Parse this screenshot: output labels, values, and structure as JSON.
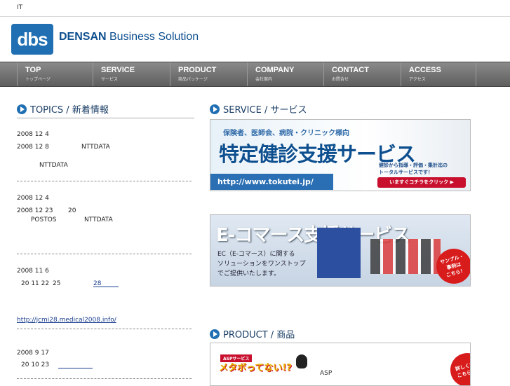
{
  "topbar": {
    "text": "IT"
  },
  "header": {
    "logo": "dbs",
    "brand_bold": "DENSAN",
    "brand_rest": " Business Solution"
  },
  "nav": [
    {
      "en": "TOP",
      "jp": "トップページ"
    },
    {
      "en": "SERVICE",
      "jp": "サービス"
    },
    {
      "en": "PRODUCT",
      "jp": "商品パッケージ"
    },
    {
      "en": "COMPANY",
      "jp": "会社案内"
    },
    {
      "en": "CONTACT",
      "jp": "お問合せ"
    },
    {
      "en": "ACCESS",
      "jp": "アクセス"
    }
  ],
  "topics": {
    "title": "TOPICS / 新着情報",
    "lines": [
      "2008 12 4",
      "2008 12 8",
      "NTTDATA",
      "NTTDATA",
      "2008 12 4",
      "2008 12 23",
      "20",
      "POSTOS",
      "NTTDATA",
      "2008 11 6",
      "20 11 22",
      "25",
      "28",
      "http://jcmi28.medical2008.info/",
      "2008 9 17",
      "20 10 23"
    ]
  },
  "service": {
    "title": "SERVICE / サービス",
    "banner1": {
      "tagline": "保険者、医師会、病院・クリニック様向",
      "headline": "特定健診支援サービス",
      "url": "http://www.tokutei.jp/",
      "desc1": "健診から指導・評価・集計迄の",
      "desc2": "トータルサービスです！",
      "cta": "いますぐコチラをクリック ▶"
    },
    "banner2": {
      "headline": "E-コマース支援サービス",
      "desc1": "EC（E-コマース）に関する",
      "desc2": "ソリューションをワンストップ",
      "desc3": "でご提供いたします。",
      "badge1": "サンプル・",
      "badge2": "事例は",
      "badge3": "こちら！"
    }
  },
  "product": {
    "title": "PRODUCT / 商品",
    "banner": {
      "tag": "ASPサービス",
      "name": "メタボってない!?",
      "asp": "ASP",
      "badge1": "詳しくは",
      "badge2": "こちら"
    }
  },
  "colors": {
    "accent": "#1f6fb2",
    "nav": "#6e6e6e",
    "cta": "#c8102e"
  }
}
